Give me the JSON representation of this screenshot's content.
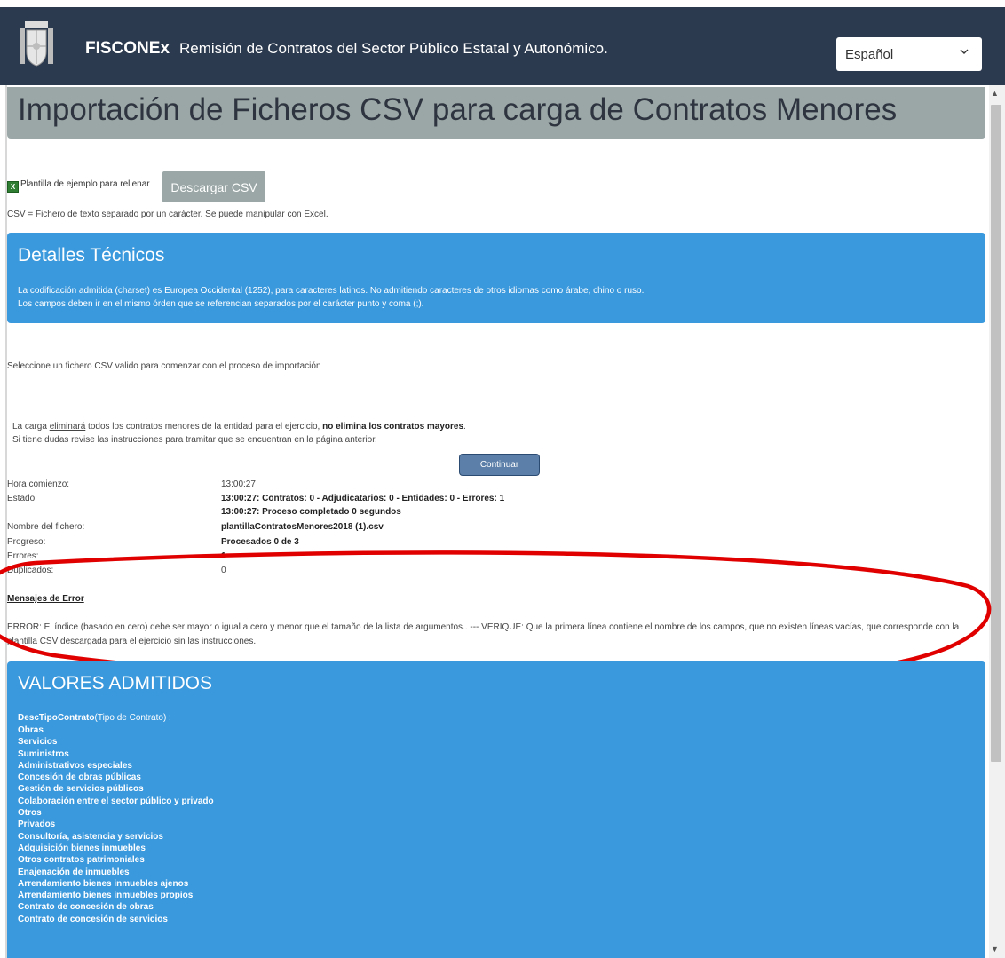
{
  "header": {
    "brand": "FISCONEx",
    "subtitle": "Remisión de Contratos del Sector Público Estatal y Autonómico.",
    "language": "Español"
  },
  "page": {
    "title": "Importación de Ficheros CSV para carga de Contratos Menores",
    "template_label": "Plantilla de ejemplo para rellenar",
    "download_button": "Descargar CSV",
    "csv_note": "CSV = Fichero de texto separado por un carácter. Se puede manipular con Excel."
  },
  "tech_details": {
    "heading": "Detalles Técnicos",
    "line1": "La codificación admitida (charset) es Europea Occidental (1252), para caracteres latinos. No admitiendo caracteres de otros idiomas como árabe, chino o ruso.",
    "line2": "Los campos deben ir en el mismo órden que se referencian separados por el carácter punto y coma (;)."
  },
  "select_hint": "Seleccione un fichero CSV valido para comenzar con el proceso de importación",
  "warning": {
    "prefix": "La carga ",
    "link": "eliminará",
    "middle": " todos los contratos menores de la entidad para el ejercicio, ",
    "bold": "no elimina los contratos mayores",
    "suffix": ".",
    "line2": "Si tiene dudas revise las instrucciones para tramitar que se encuentran en la página anterior."
  },
  "continue_button": "Continuar",
  "status": {
    "start_label": "Hora comienzo:",
    "start_value": "13:00:27",
    "state_label": "Estado:",
    "state_line1": "13:00:27: Contratos: 0 - Adjudicatarios: 0 - Entidades: 0 - Errores: 1",
    "state_line2": "13:00:27: Proceso completado 0 segundos",
    "file_label": "Nombre del fichero:",
    "file_value": "plantillaContratosMenores2018 (1).csv",
    "progress_label": "Progreso:",
    "progress_value": "Procesados 0 de 3",
    "errors_label": "Errores:",
    "errors_value": "1",
    "duplicates_label": "Duplicados:",
    "duplicates_value": "0"
  },
  "error_section": {
    "heading": "Mensajes de Error",
    "text": "ERROR: El índice (basado en cero) debe ser mayor o igual a cero y menor que el tamaño de la lista de argumentos.. --- VERIQUE: Que la primera línea contiene el nombre de los campos, que no existen líneas vacías, que corresponde con la plantilla CSV descargada para el ejercicio sin las instrucciones."
  },
  "values": {
    "heading": "VALORES ADMITIDOS",
    "field_name": "DescTipoContrato",
    "field_desc": "(Tipo de Contrato) :",
    "items": [
      "Obras",
      "Servicios",
      "Suministros",
      "Administrativos especiales",
      "Concesión de obras públicas",
      "Gestión de servicios públicos",
      "Colaboración entre el sector público y privado",
      "Otros",
      "Privados",
      "Consultoría, asistencia y servicios",
      "Adquisición bienes inmuebles",
      "Otros contratos patrimoniales",
      "Enajenación de inmuebles",
      "Arrendamiento bienes inmuebles ajenos",
      "Arrendamiento bienes inmuebles propios",
      "Contrato de concesión de obras",
      "Contrato de concesión de servicios"
    ]
  },
  "colors": {
    "header_bg": "#2c3a4f",
    "panel_blue": "#3a98dc",
    "title_gray": "#9aa7a6",
    "annotation_red": "#e00000"
  }
}
